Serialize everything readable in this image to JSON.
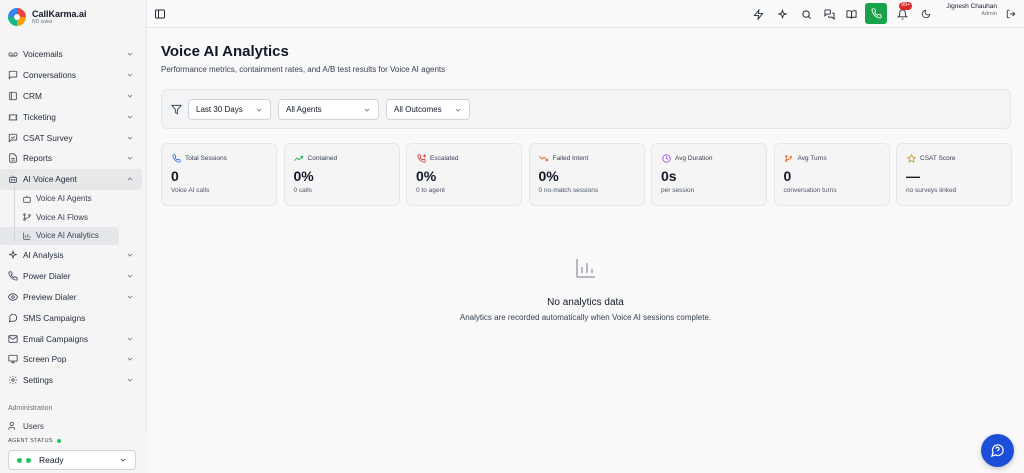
{
  "brand": {
    "name": "CallKarma.ai",
    "sub": "ND sales"
  },
  "sidebar": {
    "items": [
      {
        "label": "Voicemails",
        "icon": "voicemail-icon"
      },
      {
        "label": "Conversations",
        "icon": "message-square-icon"
      },
      {
        "label": "CRM",
        "icon": "book-icon"
      },
      {
        "label": "Ticketing",
        "icon": "ticket-icon"
      },
      {
        "label": "CSAT Survey",
        "icon": "message-check-icon"
      },
      {
        "label": "Reports",
        "icon": "file-text-icon"
      },
      {
        "label": "AI Voice Agent",
        "icon": "bot-icon"
      }
    ],
    "sub_items": [
      {
        "label": "Voice AI Agents",
        "icon": "bot-icon"
      },
      {
        "label": "Voice AI Flows",
        "icon": "git-branch-icon"
      },
      {
        "label": "Voice AI Analytics",
        "icon": "bar-chart-icon"
      }
    ],
    "items2": [
      {
        "label": "AI Analysis",
        "icon": "sparkles-icon"
      },
      {
        "label": "Power Dialer",
        "icon": "phone-call-icon"
      },
      {
        "label": "Preview Dialer",
        "icon": "eye-icon"
      },
      {
        "label": "SMS Campaigns",
        "icon": "message-icon"
      },
      {
        "label": "Email Campaigns",
        "icon": "mail-icon"
      },
      {
        "label": "Screen Pop",
        "icon": "monitor-icon"
      },
      {
        "label": "Settings",
        "icon": "gear-icon"
      }
    ],
    "section_label": "Administration",
    "users_label": "Users",
    "agent_status_title": "AGENT STATUS",
    "agent_status_value": "Ready"
  },
  "topbar": {
    "notifications_badge": "99+",
    "user_name": "Jignesh Chauhan",
    "user_role": "Admin"
  },
  "page": {
    "title": "Voice AI Analytics",
    "subtitle": "Performance metrics, containment rates, and A/B test results for Voice AI agents"
  },
  "filters": {
    "period": "Last 30 Days",
    "agents": "All Agents",
    "outcomes": "All Outcomes"
  },
  "stats": [
    {
      "label": "Total Sessions",
      "value": "0",
      "sub": "Voice AI calls",
      "icon": "phone-icon",
      "color": "#2563eb"
    },
    {
      "label": "Contained",
      "value": "0%",
      "sub": "0 calls",
      "icon": "trending-up-icon",
      "color": "#16a34a"
    },
    {
      "label": "Escalated",
      "value": "0%",
      "sub": "0 to agent",
      "icon": "phone-forward-icon",
      "color": "#dc2626"
    },
    {
      "label": "Failed Intent",
      "value": "0%",
      "sub": "0 no-match sessions",
      "icon": "trending-down-icon",
      "color": "#ea580c"
    },
    {
      "label": "Avg Duration",
      "value": "0s",
      "sub": "per session",
      "icon": "clock-icon",
      "color": "#9333ea"
    },
    {
      "label": "Avg Turns",
      "value": "0",
      "sub": "conversation turns",
      "icon": "git-branch-icon",
      "color": "#ea580c"
    },
    {
      "label": "CSAT Score",
      "value": "—",
      "sub": "no surveys linked",
      "icon": "star-icon",
      "color": "#ca8a04"
    }
  ],
  "empty": {
    "title": "No analytics data",
    "subtitle": "Analytics are recorded automatically when Voice AI sessions complete."
  }
}
